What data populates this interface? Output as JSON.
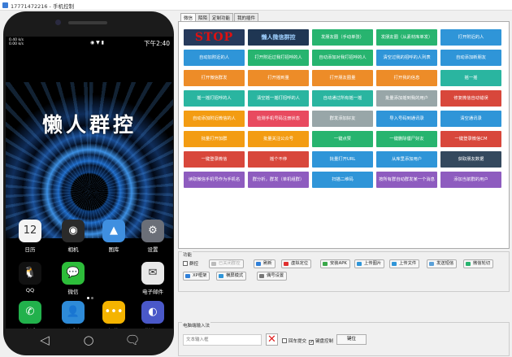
{
  "window": {
    "title": "17771472216 - 手机控制"
  },
  "phone": {
    "status_left_1": "0.40 k/s",
    "status_left_2": "0.00 k/s",
    "status_icons": "◉ ▼ ▮",
    "time": "下午2:40",
    "slogan": "懒人群控",
    "apps": [
      {
        "label": "日历",
        "icon": "calendar-icon",
        "glyph": "12"
      },
      {
        "label": "相机",
        "icon": "camera-icon",
        "glyph": "◉"
      },
      {
        "label": "图库",
        "icon": "gallery-icon",
        "glyph": "▲"
      },
      {
        "label": "设置",
        "icon": "settings-icon",
        "glyph": "⚙"
      },
      {
        "label": "QQ",
        "icon": "qq-icon",
        "glyph": "🐧"
      },
      {
        "label": "微信",
        "icon": "wechat-icon",
        "glyph": "💬"
      },
      {
        "label": "电子邮件",
        "icon": "mail-icon",
        "glyph": "✉"
      },
      {
        "label": "电话",
        "icon": "phone-icon",
        "glyph": "✆"
      },
      {
        "label": "联系人",
        "icon": "contacts-icon",
        "glyph": "👤"
      },
      {
        "label": "短信",
        "icon": "sms-icon",
        "glyph": "•••"
      },
      {
        "label": "浏览器",
        "icon": "browser-icon",
        "glyph": "◐"
      }
    ],
    "nav": [
      "◁",
      "○",
      "🗨"
    ]
  },
  "tabs": [
    "微信",
    "陌陌",
    "定制功能",
    "我的插件"
  ],
  "buttons": [
    {
      "label": "STOP",
      "color": "#263a5c"
    },
    {
      "label": "懒人微信群控",
      "color": "#1f3653"
    },
    {
      "label": "发朋友圈（手动单张）",
      "color": "#27b46f"
    },
    {
      "label": "发朋友圈（从素材库单发）",
      "color": "#27b46f"
    },
    {
      "label": "打开附近的人",
      "color": "#2f95d8"
    },
    {
      "label": "自动加附近的人",
      "color": "#2f95d8"
    },
    {
      "label": "打开附近过我打招呼的人",
      "color": "#27b46f"
    },
    {
      "label": "自动添加对我打招呼的人",
      "color": "#27b46f"
    },
    {
      "label": "清空过我的招呼的人列表",
      "color": "#2f95d8"
    },
    {
      "label": "自动添加新朋友",
      "color": "#2f95d8"
    },
    {
      "label": "打开微信群发",
      "color": "#ed8c28"
    },
    {
      "label": "打开摇到量",
      "color": "#ed8c28"
    },
    {
      "label": "打开朋友圈量",
      "color": "#ed8c28"
    },
    {
      "label": "打开我的信息",
      "color": "#ed8c28"
    },
    {
      "label": "摇一摇",
      "color": "#2ab5a0"
    },
    {
      "label": "摇一摇打招呼的人",
      "color": "#2ab5a0"
    },
    {
      "label": "清空摇一摇打招呼的人",
      "color": "#2ab5a0"
    },
    {
      "label": "自动通过所有摇一摇",
      "color": "#2ab5a0"
    },
    {
      "label": "批量添加摇到我的用户",
      "color": "#98a6a8"
    },
    {
      "label": "修复微信自动错误",
      "color": "#d8473b"
    },
    {
      "label": "自动添加附近微信的人",
      "color": "#f39c12"
    },
    {
      "label": "检测手机号码注册状态",
      "color": "#e84a5f"
    },
    {
      "label": "群发添加好友",
      "color": "#98a6a8"
    },
    {
      "label": "导入号码到通讯录",
      "color": "#2f95d8"
    },
    {
      "label": "清空通讯录",
      "color": "#2f95d8"
    },
    {
      "label": "批量打开加群",
      "color": "#f39c12"
    },
    {
      "label": "批量关注公众号",
      "color": "#f39c12"
    },
    {
      "label": "一键点赞",
      "color": "#27b46f"
    },
    {
      "label": "一键删除僵尸好友",
      "color": "#27b46f"
    },
    {
      "label": "一键登录微信CM",
      "color": "#d8473b"
    },
    {
      "label": "一键登录微信",
      "color": "#d8473b"
    },
    {
      "label": "摇个不停",
      "color": "#d8473b"
    },
    {
      "label": "批量打开URL",
      "color": "#2f95d8"
    },
    {
      "label": "从库里添加用户",
      "color": "#2f95d8"
    },
    {
      "label": "获取朋友数据",
      "color": "#34495e"
    },
    {
      "label": "读取微信手机号作为手机名",
      "color": "#8e5cbf"
    },
    {
      "label": "群分析，群发（单机组群）",
      "color": "#8e5cbf"
    },
    {
      "label": "扫描二维码",
      "color": "#2f95d8"
    },
    {
      "label": "按所有群自动群发某一个消息",
      "color": "#8e5cbf"
    },
    {
      "label": "添加当前群的用户",
      "color": "#8e5cbf"
    }
  ],
  "func": {
    "title": "功能",
    "lock_label": "群控",
    "row1": [
      {
        "label": "已关闭群控",
        "icon": "lock-icon",
        "color": "#bbbbbb",
        "disabled": true
      },
      {
        "label": "刷新",
        "icon": "refresh-icon",
        "color": "#2f7fd8"
      },
      {
        "label": "虚拟定位",
        "icon": "location-icon",
        "color": "#e03030"
      },
      {
        "label": "安装APK",
        "icon": "install-icon",
        "color": "#3aa84a"
      },
      {
        "label": "上传图片",
        "icon": "upload-image-icon",
        "color": "#2f95d8"
      },
      {
        "label": "上传文件",
        "icon": "upload-file-icon",
        "color": "#2f95d8"
      },
      {
        "label": "发送短信",
        "icon": "sms-send-icon",
        "color": "#5aa0d8"
      },
      {
        "label": "微信轮切",
        "icon": "wechat-switch-icon",
        "color": "#27b46f"
      }
    ],
    "row2": [
      {
        "label": "XP框架",
        "icon": "framework-icon",
        "color": "#2f7fd8"
      },
      {
        "label": "横屏模式",
        "icon": "landscape-icon",
        "color": "#2f95d8"
      },
      {
        "label": "偶号设置",
        "icon": "account-settings-icon",
        "color": "#777777"
      }
    ]
  },
  "input_group": {
    "title": "电脑端输入法",
    "placeholder": "文本输入框",
    "clear_glyph": "✕",
    "echo_label": "回车提交",
    "keyboard_label": "键盘控制",
    "key_button": "键位"
  }
}
